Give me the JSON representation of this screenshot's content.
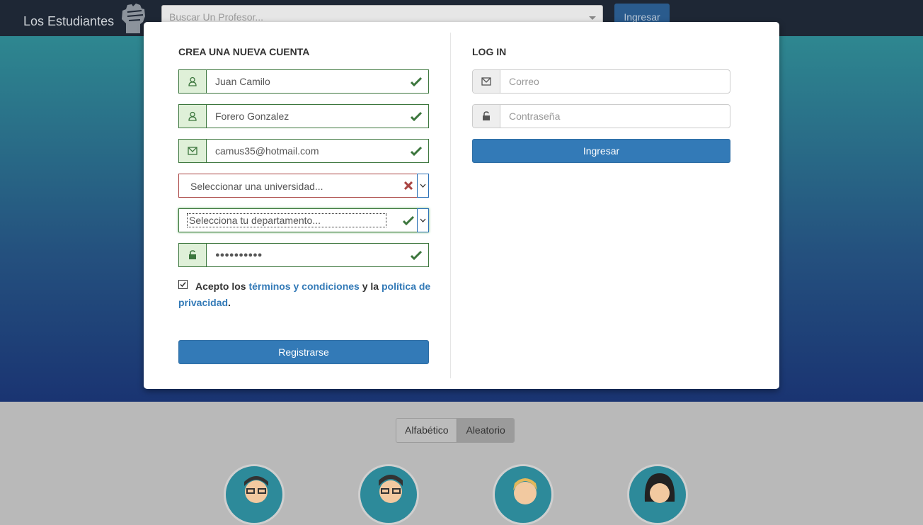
{
  "navbar": {
    "brand": "Los Estudiantes",
    "search_placeholder": "Buscar Un Profesor...",
    "login_label": "Ingresar"
  },
  "sort": {
    "alphabetic_label": "Alfabético",
    "random_label": "Aleatorio"
  },
  "register": {
    "title": "CREA UNA NUEVA CUENTA",
    "first_name": "Juan Camilo",
    "last_name": "Forero Gonzalez",
    "email": "camus35@hotmail.com",
    "university_placeholder": "Seleccionar una universidad...",
    "department_placeholder": "Selecciona tu departamento...",
    "password_mask": "●●●●●●●●●●",
    "terms_prefix": "Acepto los ",
    "terms_link": "términos y condiciones",
    "terms_mid": " y la ",
    "privacy_link": "política de privacidad",
    "terms_suffix": ".",
    "submit_label": "Registrarse"
  },
  "login": {
    "title": "LOG IN",
    "email_placeholder": "Correo",
    "password_placeholder": "Contraseña",
    "submit_label": "Ingresar"
  },
  "colors": {
    "success": "#3c763d",
    "error": "#a94442",
    "primary": "#337ab7"
  }
}
